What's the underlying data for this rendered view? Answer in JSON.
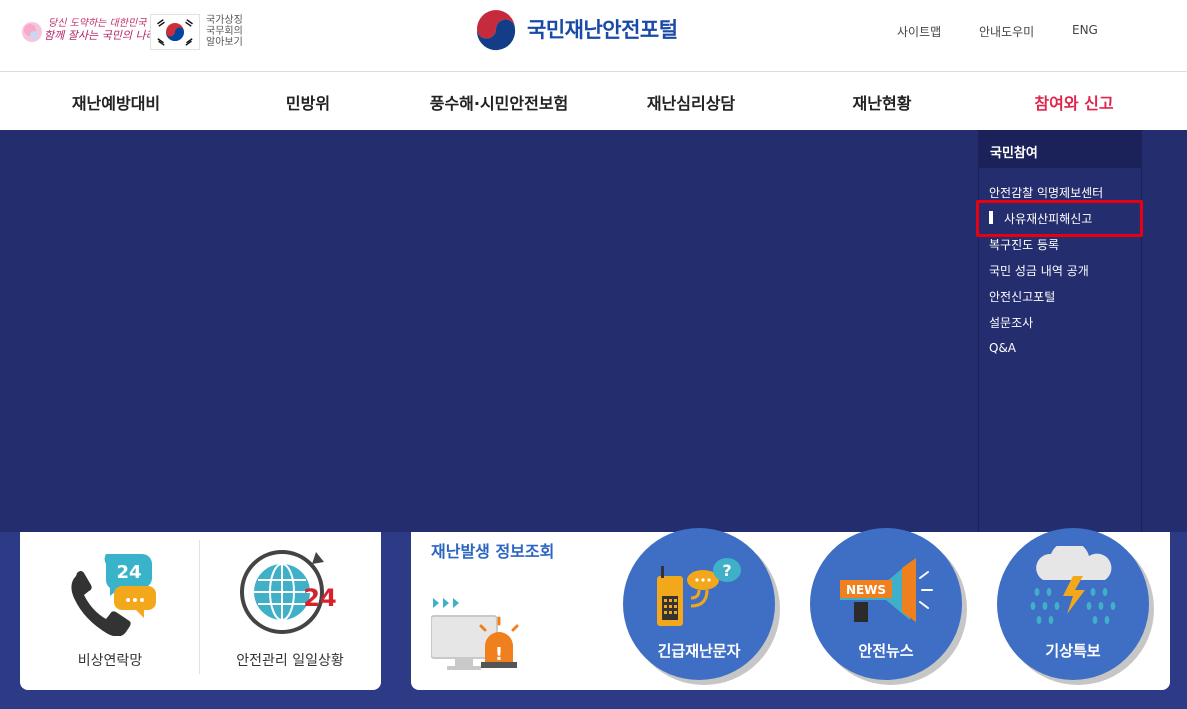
{
  "header": {
    "slogan_line1": "당신 도약하는 대한민국",
    "slogan_line2": "함께 잘사는 국민의 나라",
    "emblem_text": [
      "국가상징",
      "국무회의",
      "알아보기"
    ],
    "site_title": "국민재난안전포털",
    "util_links": [
      "사이트맵",
      "안내도우미",
      "ENG"
    ]
  },
  "gnb": {
    "items": [
      "재난예방대비",
      "민방위",
      "풍수해·시민안전보험",
      "재난심리상담",
      "재난현황",
      "참여와 신고"
    ],
    "active_index": 5
  },
  "submenu": {
    "heading": "국민참여",
    "items": [
      "안전감찰 익명제보센터",
      "사유재산피해신고",
      "복구진도 등록",
      "국민 성금 내역 공개",
      "안전신고포털",
      "설문조사",
      "Q&A"
    ],
    "active_index": 1
  },
  "quick_links": {
    "items": [
      "비상연락망",
      "안전관리 일일상황"
    ],
    "badge_24": "24"
  },
  "info": {
    "title": "재난발생 정보조회",
    "circles": [
      "긴급재난문자",
      "안전뉴스",
      "기상특보"
    ],
    "news_badge": "NEWS"
  },
  "colors": {
    "navy": "#2d3a86",
    "dropdown_navy": "#242d6e",
    "submenu_head": "#1b2259",
    "active_menu": "#e0264a",
    "highlight_box": "#e60012",
    "circle_blue": "#3f6fc4",
    "title_blue": "#2b65c3"
  }
}
